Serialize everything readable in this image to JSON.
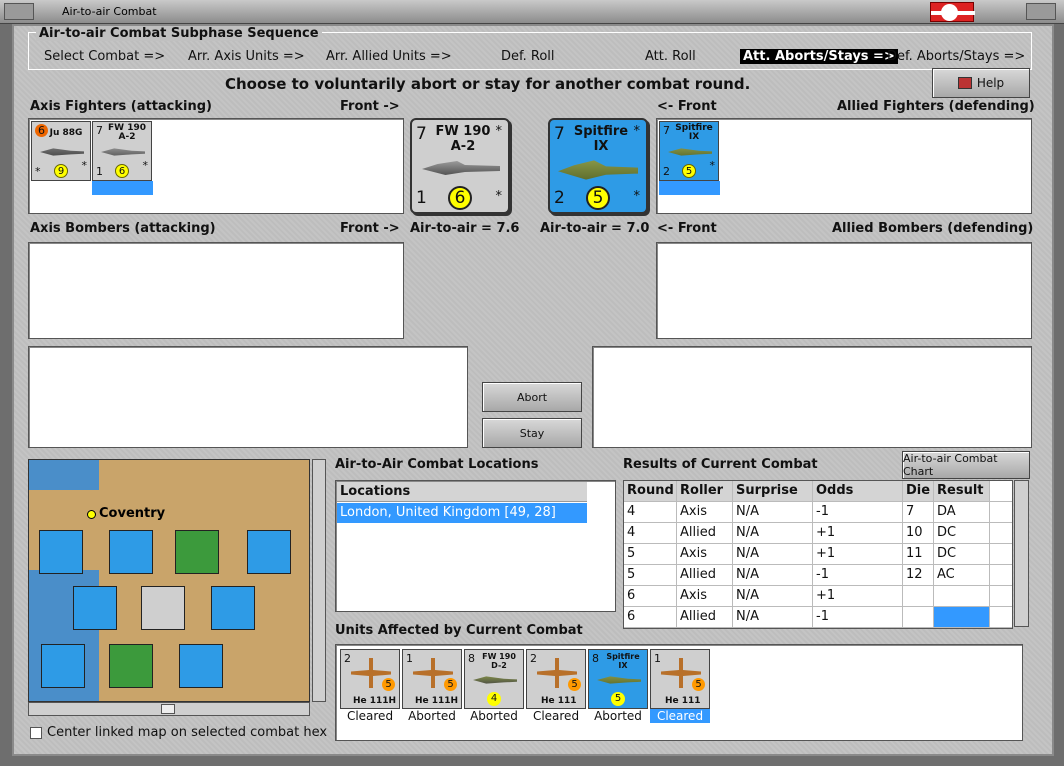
{
  "window": {
    "title": "Air-to-air Combat"
  },
  "phase": {
    "title": "Air-to-air Combat Subphase Sequence",
    "steps": [
      "Select Combat =>",
      "Arr. Axis Units =>",
      "Arr. Allied Units =>",
      "Def. Roll",
      "Att. Roll",
      "Att. Aborts/Stays =>",
      "Def. Aborts/Stays =>"
    ],
    "active_step": "Att. Aborts/Stays =>"
  },
  "instruction": "Choose to voluntarily abort or stay for another combat round.",
  "help_label": "Help",
  "axis_fighters": {
    "label": "Axis Fighters (attacking)",
    "front": "Front ->"
  },
  "allied_fighters": {
    "label": "Allied Fighters (defending)",
    "front": "<- Front"
  },
  "axis_bombers": {
    "label": "Axis Bombers (attacking)",
    "front": "Front ->"
  },
  "allied_bombers": {
    "label": "Allied Bombers (defending)",
    "front": "<- Front"
  },
  "axis_counters": [
    {
      "name": "Ju 88G",
      "tl": "6",
      "bl": "*",
      "br": "*",
      "die": "9"
    },
    {
      "name": "FW 190 A-2",
      "tl": "7",
      "bl": "1",
      "br": "*",
      "die": "6"
    }
  ],
  "allied_counters": [
    {
      "name": "Spitfire IX",
      "tl": "7",
      "bl": "2",
      "br": "*",
      "die": "5"
    }
  ],
  "big_axis": {
    "top": "7",
    "name": "FW 190 A-2",
    "star": "*",
    "bottom": "1",
    "die": "6",
    "air_to_air": "Air-to-air = 7.6"
  },
  "big_allied": {
    "top": "7",
    "name": "Spitfire IX",
    "star": "*",
    "bottom": "2",
    "die": "5",
    "air_to_air": "Air-to-air = 7.0"
  },
  "buttons": {
    "abort": "Abort",
    "stay": "Stay",
    "chart": "Air-to-air Combat Chart"
  },
  "map": {
    "city": "Coventry",
    "checkbox_label": "Center linked map on selected combat hex"
  },
  "locations": {
    "section": "Air-to-Air Combat Locations",
    "header": "Locations",
    "items": [
      "London, United Kingdom [49, 28]"
    ]
  },
  "results": {
    "section": "Results of Current Combat",
    "columns": [
      "Round",
      "Roller",
      "Surprise",
      "Odds",
      "Die",
      "Result"
    ],
    "rows": [
      [
        "4",
        "Axis",
        "N/A",
        "-1",
        "7",
        "DA"
      ],
      [
        "4",
        "Allied",
        "N/A",
        "+1",
        "10",
        "DC"
      ],
      [
        "5",
        "Axis",
        "N/A",
        "+1",
        "11",
        "DC"
      ],
      [
        "5",
        "Allied",
        "N/A",
        "-1",
        "12",
        "AC"
      ],
      [
        "6",
        "Axis",
        "N/A",
        "+1",
        "",
        ""
      ],
      [
        "6",
        "Allied",
        "N/A",
        "-1",
        "",
        ""
      ]
    ]
  },
  "affected": {
    "section": "Units Affected by Current Combat",
    "units": [
      {
        "name": "He 111H",
        "top": "2",
        "die": "5",
        "status": "Cleared"
      },
      {
        "name": "He 111H",
        "top": "1",
        "die": "5",
        "status": "Aborted"
      },
      {
        "name": "FW 190 D-2",
        "top": "8",
        "die": "4",
        "status": "Aborted"
      },
      {
        "name": "He 111",
        "top": "2",
        "die": "5",
        "status": "Cleared"
      },
      {
        "name": "Spitfire IX",
        "top": "8",
        "die": "5",
        "status": "Aborted"
      },
      {
        "name": "He 111",
        "top": "1",
        "die": "5",
        "status": "Cleared"
      }
    ]
  }
}
